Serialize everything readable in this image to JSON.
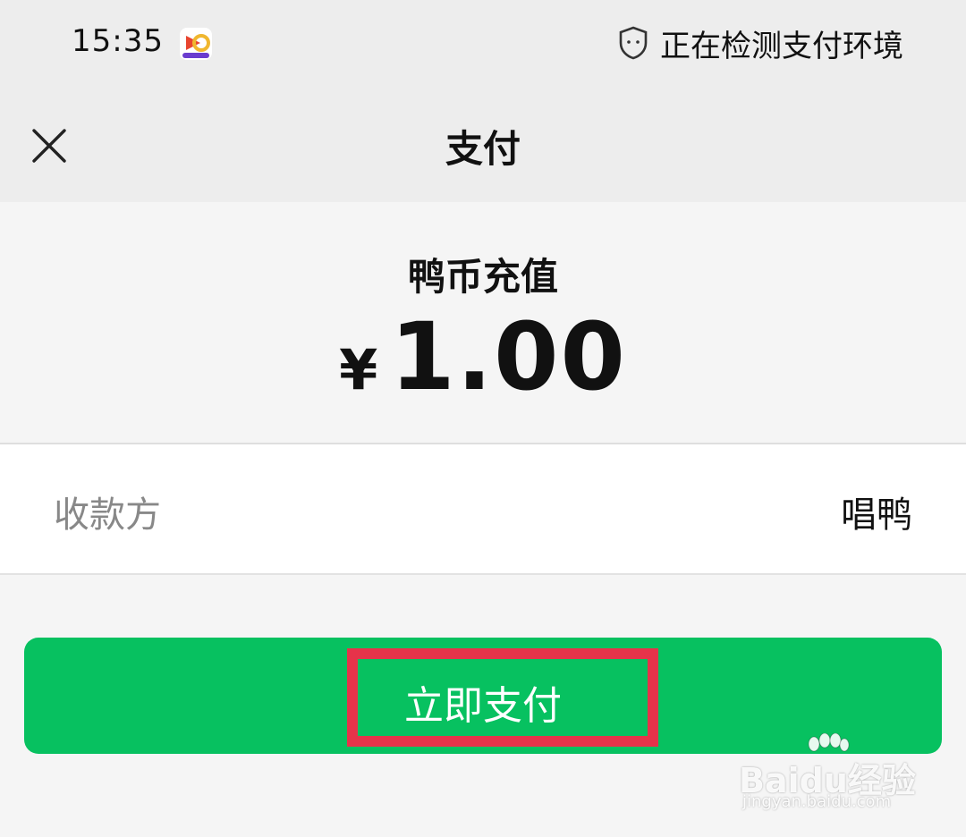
{
  "status_bar": {
    "time": "15:35",
    "app_icon": "video-app-icon",
    "security_text": "正在检测支付环境",
    "security_icon": "shield-icon"
  },
  "nav": {
    "close_icon": "close-icon",
    "title": "支付"
  },
  "order": {
    "name": "鸭币充值",
    "currency_symbol": "¥",
    "amount": "1.00"
  },
  "payee": {
    "label": "收款方",
    "value": "唱鸭"
  },
  "pay_button": {
    "label": "立即支付",
    "color": "#07c160"
  },
  "annotation": {
    "highlight_color": "#e6334a"
  },
  "watermark": {
    "logo": "Baidu经验",
    "url": "jingyan.baidu.com"
  }
}
